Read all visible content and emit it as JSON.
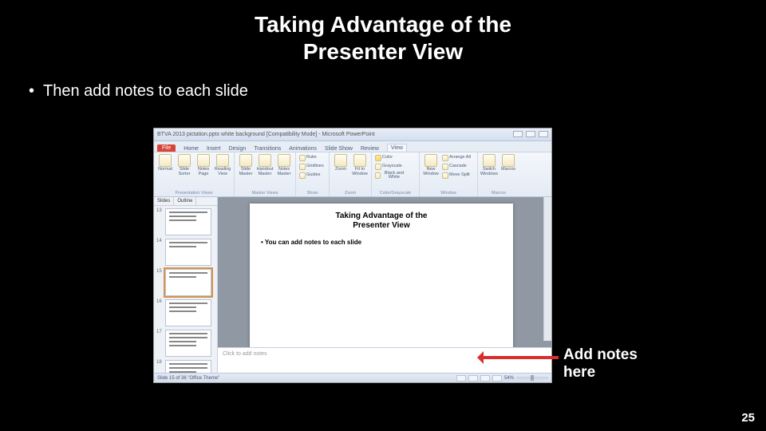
{
  "title_line1": "Taking Advantage of the",
  "title_line2": "Presenter View",
  "bullet": "Then add notes to each slide",
  "annotation_l1": "Add notes",
  "annotation_l2": "here",
  "page_number": "25",
  "powerpoint": {
    "window_title": "BTVA 2013 pictation.pptx white background [Compatibility Mode] - Microsoft PowerPoint",
    "ribbon": {
      "file": "File",
      "tabs": [
        "Home",
        "Insert",
        "Design",
        "Transitions",
        "Animations",
        "Slide Show",
        "Review",
        "View"
      ],
      "active_tab": "View",
      "groups": {
        "presentation_views": {
          "label": "Presentation Views",
          "items": [
            "Normal",
            "Slide Sorter",
            "Notes Page",
            "Reading View"
          ]
        },
        "master_views": {
          "label": "Master Views",
          "items": [
            "Slide Master",
            "Handout Master",
            "Notes Master"
          ]
        },
        "show": {
          "label": "Show",
          "items": [
            "Ruler",
            "Gridlines",
            "Guides"
          ]
        },
        "zoom": {
          "label": "Zoom",
          "items": [
            "Zoom",
            "Fit to Window"
          ]
        },
        "color": {
          "label": "Color/Grayscale",
          "items": [
            "Color",
            "Grayscale",
            "Black and White"
          ]
        },
        "window": {
          "label": "Window",
          "items": [
            "New Window",
            "Arrange All",
            "Cascade",
            "Move Split"
          ]
        },
        "macros": {
          "label": "Macros",
          "items": [
            "Switch Windows",
            "Macros"
          ]
        }
      }
    },
    "sidepane": {
      "tabs": [
        "Slides",
        "Outline"
      ],
      "thumbs": [
        "13",
        "14",
        "15",
        "16",
        "17",
        "18"
      ]
    },
    "canvas": {
      "title_l1": "Taking Advantage of the",
      "title_l2": "Presenter View",
      "bullet": "You can add notes to each slide"
    },
    "notes_placeholder": "Click to add notes",
    "status": {
      "left": "Slide 15 of 36    \"Office Theme\"",
      "zoom": "54%"
    }
  }
}
